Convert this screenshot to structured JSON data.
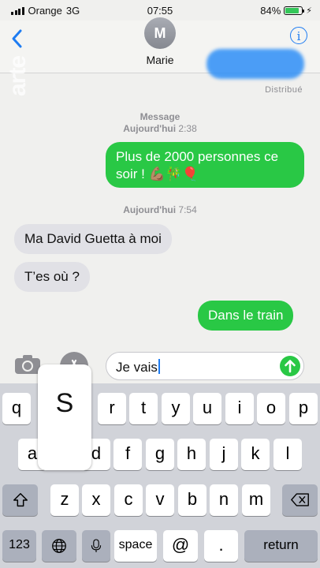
{
  "status": {
    "carrier": "Orange",
    "network": "3G",
    "time": "07:55",
    "battery": "84%",
    "battery_level": 0.84
  },
  "header": {
    "avatar_initial": "M",
    "contact_name": "Marie",
    "back_icon": "chevron-left-icon",
    "info_icon": "info-icon"
  },
  "watermark": "arte",
  "conversation": {
    "delivered": "Distribué",
    "ts1_label": "Message",
    "ts1_day": "Aujourd'hui",
    "ts1_time": "2:38",
    "msg1": "Plus de 2000 personnes ce soir ! 💪🏽🎋🎈",
    "ts2_day": "Aujourd'hui",
    "ts2_time": "7:54",
    "msg2": "Ma David Guetta à moi",
    "msg3": "T’es où ?",
    "msg4": "Dans le train"
  },
  "compose": {
    "text": "Je vais",
    "camera_icon": "camera-icon",
    "apps_icon": "app-store-icon",
    "send_icon": "send-arrow-icon"
  },
  "keyboard": {
    "popup_letter": "S",
    "row1": [
      "q",
      "",
      "",
      "r",
      "t",
      "y",
      "u",
      "i",
      "o",
      "p"
    ],
    "row2": [
      "a",
      "",
      "d",
      "f",
      "g",
      "h",
      "j",
      "k",
      "l"
    ],
    "row3": [
      "z",
      "x",
      "c",
      "v",
      "b",
      "n",
      "m"
    ],
    "numbers": "123",
    "space": "space",
    "at": "@",
    "dot": ".",
    "return": "return"
  },
  "colors": {
    "imessage_green": "#29c845",
    "received_grey": "#e1e1e6",
    "ios_blue": "#1e7cf2"
  }
}
